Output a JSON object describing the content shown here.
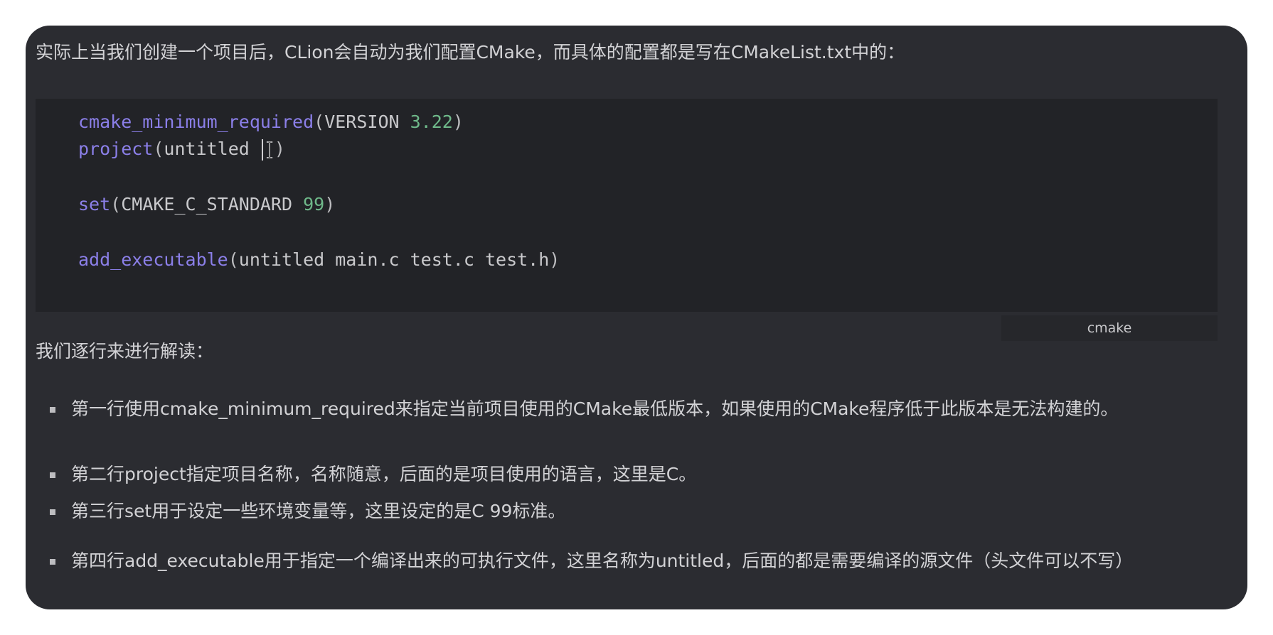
{
  "intro_text": "实际上当我们创建一个项目后，CLion会自动为我们配置CMake，而具体的配置都是写在CMakeList.txt中的：",
  "code": {
    "line1": {
      "fn": "cmake_minimum_required",
      "open": "(",
      "arg": "VERSION ",
      "num": "3.22",
      "close": ")"
    },
    "line2": {
      "fn": "project",
      "open": "(",
      "arg": "untitled ",
      "close": ")"
    },
    "line3": {
      "fn": "set",
      "open": "(",
      "arg": "CMAKE_C_STANDARD ",
      "num": "99",
      "close": ")"
    },
    "line4": {
      "fn": "add_executable",
      "open": "(",
      "arg": "untitled main.c test.c test.h",
      "close": ")"
    },
    "language": "cmake"
  },
  "lead_text": "我们逐行来进行解读：",
  "bullets": [
    "第一行使用cmake_minimum_required来指定当前项目使用的CMake最低版本，如果使用的CMake程序低于此版本是无法构建的。",
    "第二行project指定项目名称，名称随意，后面的是项目使用的语言，这里是C。",
    "第三行set用于设定一些环境变量等，这里设定的是C 99标准。",
    "第四行add_executable用于指定一个编译出来的可执行文件，这里名称为untitled，后面的都是需要编译的源文件（头文件可以不写）"
  ],
  "colors": {
    "card_background": "#2b2c31",
    "code_background": "#222327",
    "function_color": "#8b7fe8",
    "number_color": "#6fb98a"
  }
}
